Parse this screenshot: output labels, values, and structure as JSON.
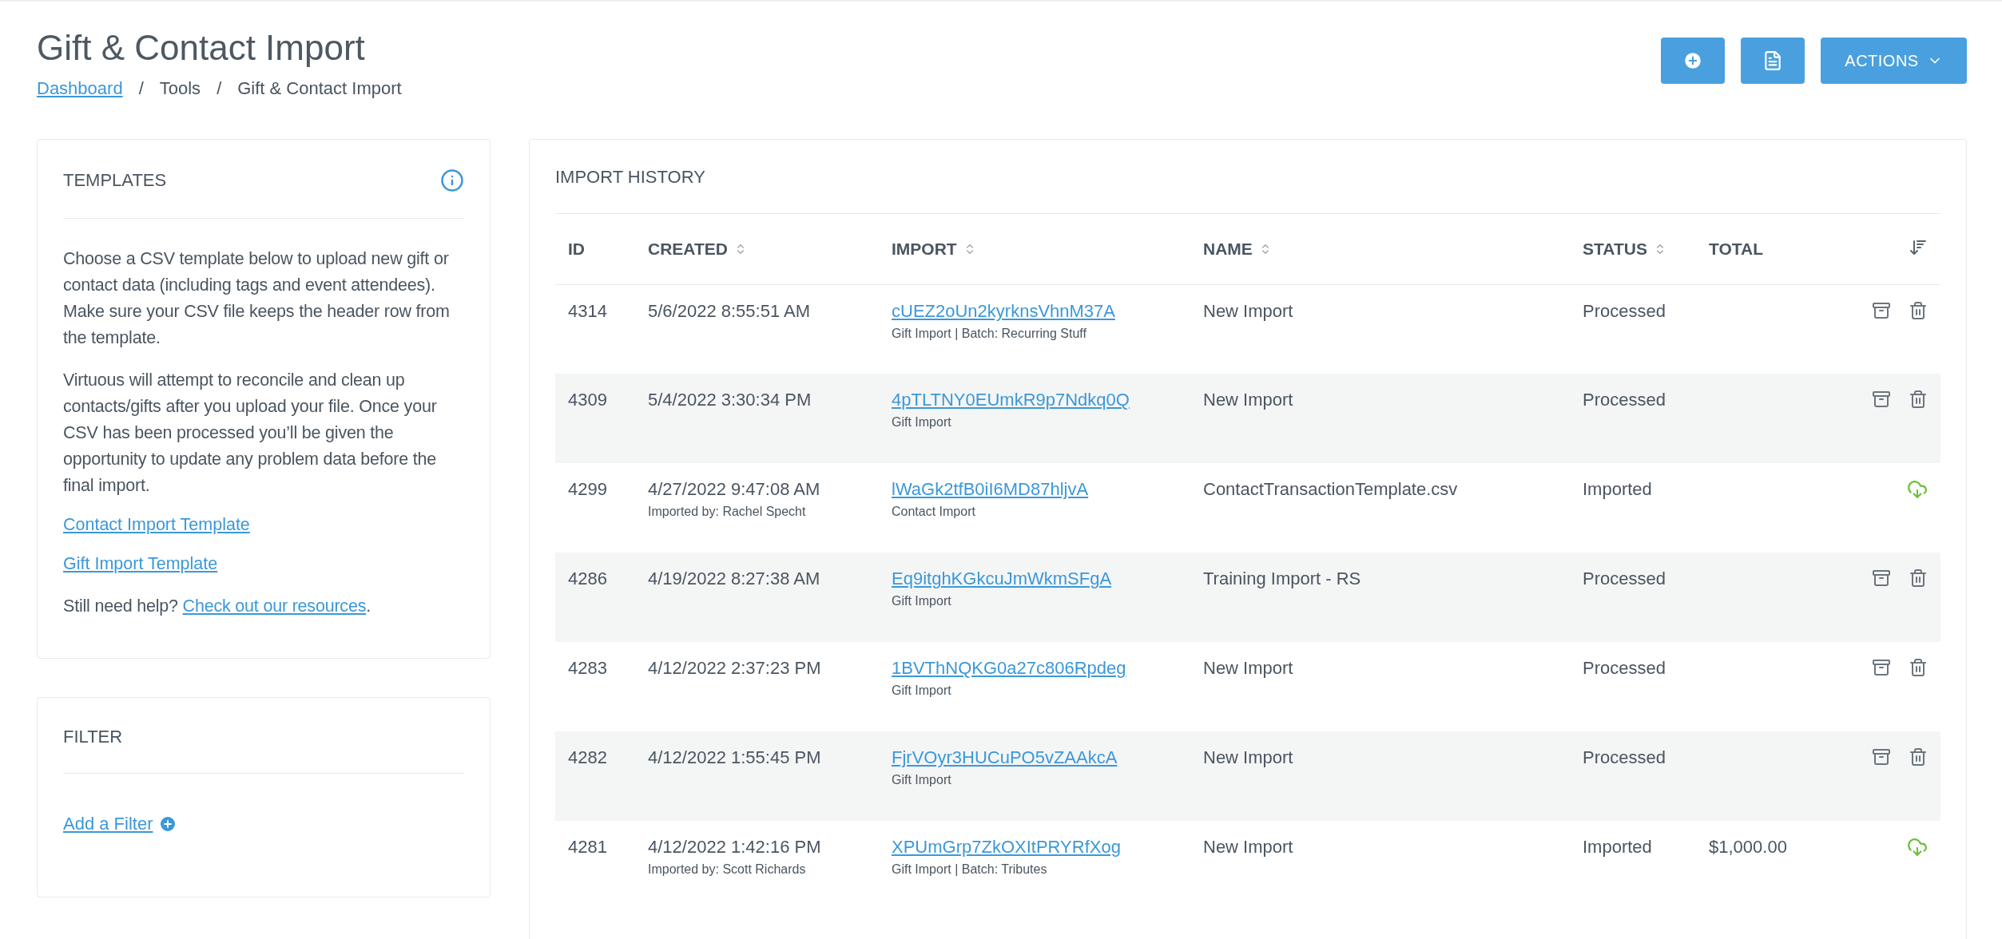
{
  "page": {
    "title": "Gift & Contact Import",
    "breadcrumbs": [
      {
        "kind": "link",
        "label": "Dashboard"
      },
      {
        "kind": "separator",
        "label": "/"
      },
      {
        "kind": "text",
        "label": "Tools"
      },
      {
        "kind": "separator",
        "label": "/"
      },
      {
        "kind": "text",
        "label": "Gift & Contact Import"
      }
    ],
    "actions_button": "ACTIONS"
  },
  "templates": {
    "title": "TEMPLATES",
    "paragraphs": [
      "Choose a CSV template below to upload new gift or contact data (including tags and event attendees). Make sure your CSV file keeps the header row from the template.",
      "Virtuous will attempt to reconcile and clean up contacts/gifts after you upload your file. Once your CSV has been processed you’ll be given the opportunity to update any problem data before the final import."
    ],
    "links": [
      "Contact Import Template",
      "Gift Import Template"
    ],
    "help_text": "Still need help?",
    "help_link": "Check out our resources",
    "help_end": "."
  },
  "filter": {
    "title": "FILTER",
    "add_link": "Add a Filter"
  },
  "import_history": {
    "title": "IMPORT HISTORY",
    "columns": [
      {
        "label": "ID",
        "sortable": false
      },
      {
        "label": "CREATED",
        "sortable": true
      },
      {
        "label": "IMPORT",
        "sortable": true
      },
      {
        "label": "NAME",
        "sortable": true
      },
      {
        "label": "STATUS",
        "sortable": true
      },
      {
        "label": "TOTAL",
        "sortable": false
      }
    ],
    "rows": [
      {
        "id": "4314",
        "created": "5/6/2022 8:55:51 AM",
        "imported_by": "",
        "import_code": "cUEZ2oUn2kyrknsVhnM37A",
        "import_detail": "Gift Import | Batch: Recurring Stuff",
        "name": "New Import",
        "status": "Processed",
        "total": "",
        "kind": "archive"
      },
      {
        "id": "4309",
        "created": "5/4/2022 3:30:34 PM",
        "imported_by": "",
        "import_code": "4pTLTNY0EUmkR9p7Ndkq0Q",
        "import_detail": "Gift Import",
        "name": "New Import",
        "status": "Processed",
        "total": "",
        "kind": "archive"
      },
      {
        "id": "4299",
        "created": "4/27/2022 9:47:08 AM",
        "imported_by": "Imported by: Rachel Specht",
        "import_code": "lWaGk2tfB0iI6MD87hljvA",
        "import_detail": "Contact Import",
        "name": "ContactTransactionTemplate.csv",
        "status": "Imported",
        "total": "",
        "kind": "download"
      },
      {
        "id": "4286",
        "created": "4/19/2022 8:27:38 AM",
        "imported_by": "",
        "import_code": "Eq9itghKGkcuJmWkmSFgA",
        "import_detail": "Gift Import",
        "name": "Training Import - RS",
        "status": "Processed",
        "total": "",
        "kind": "archive"
      },
      {
        "id": "4283",
        "created": "4/12/2022 2:37:23 PM",
        "imported_by": "",
        "import_code": "1BVThNQKG0a27c806Rpdeg",
        "import_detail": "Gift Import",
        "name": "New Import",
        "status": "Processed",
        "total": "",
        "kind": "archive"
      },
      {
        "id": "4282",
        "created": "4/12/2022 1:55:45 PM",
        "imported_by": "",
        "import_code": "FjrVOyr3HUCuPO5vZAAkcA",
        "import_detail": "Gift Import",
        "name": "New Import",
        "status": "Processed",
        "total": "",
        "kind": "archive"
      },
      {
        "id": "4281",
        "created": "4/12/2022 1:42:16 PM",
        "imported_by": "Imported by: Scott Richards",
        "import_code": "XPUmGrp7ZkOXItPRYRfXog",
        "import_detail": "Gift Import | Batch: Tributes",
        "name": "New Import",
        "status": "Imported",
        "total": "$1,000.00",
        "kind": "download"
      }
    ]
  }
}
